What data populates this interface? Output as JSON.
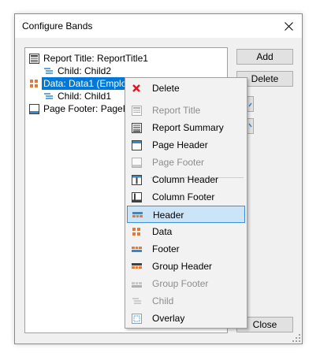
{
  "window": {
    "title": "Configure Bands"
  },
  "tree": {
    "items": [
      {
        "label": "Report Title: ReportTitle1",
        "icon": "report-title-icon"
      },
      {
        "label": "Child: Child2",
        "icon": "child-band-icon"
      },
      {
        "label": "Data: Data1 (Employe",
        "icon": "data-band-icon",
        "selected": true
      },
      {
        "label": "Child: Child1",
        "icon": "child-band-icon"
      },
      {
        "label": "Page Footer: PageFo",
        "icon": "page-footer-icon"
      }
    ]
  },
  "buttons": {
    "add": "Add",
    "delete": "Delete",
    "close": "Close"
  },
  "context_menu": {
    "items": [
      {
        "label": "Delete",
        "icon": "delete-x-icon",
        "enabled": true
      },
      {
        "label": "Report Title",
        "icon": "report-title-icon",
        "enabled": false
      },
      {
        "label": "Report Summary",
        "icon": "report-summary-icon",
        "enabled": true
      },
      {
        "label": "Page Header",
        "icon": "page-header-icon",
        "enabled": true
      },
      {
        "label": "Page Footer",
        "icon": "page-footer-icon",
        "enabled": false
      },
      {
        "label": "Column Header",
        "icon": "column-header-icon",
        "enabled": true
      },
      {
        "label": "Column Footer",
        "icon": "column-footer-icon",
        "enabled": true
      },
      {
        "label": "Header",
        "icon": "header-band-icon",
        "enabled": true,
        "highlighted": true
      },
      {
        "label": "Data",
        "icon": "data-band-icon",
        "enabled": true
      },
      {
        "label": "Footer",
        "icon": "footer-band-icon",
        "enabled": true
      },
      {
        "label": "Group Header",
        "icon": "group-header-icon",
        "enabled": true
      },
      {
        "label": "Group Footer",
        "icon": "group-footer-icon",
        "enabled": false
      },
      {
        "label": "Child",
        "icon": "child-band-icon",
        "enabled": false
      },
      {
        "label": "Overlay",
        "icon": "overlay-icon",
        "enabled": true
      }
    ]
  },
  "colors": {
    "selection": "#0078d7",
    "highlight": "#cce4f7",
    "delete_red": "#e81123",
    "band_orange": "#e07b39",
    "band_blue": "#3a87c8"
  }
}
